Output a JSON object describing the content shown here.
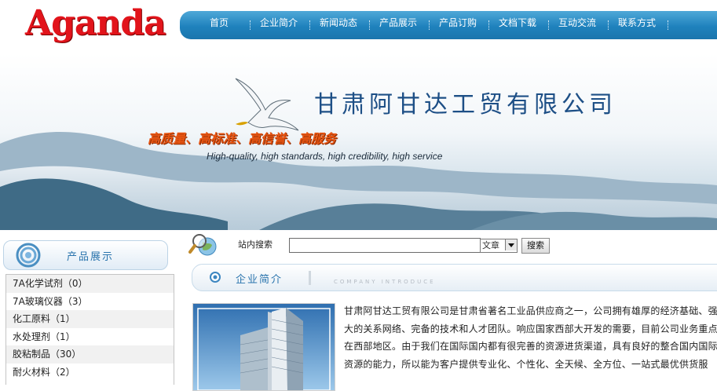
{
  "brand": {
    "logo_text": "Aganda"
  },
  "nav": {
    "items": [
      "首页",
      "企业简介",
      "新闻动态",
      "产品展示",
      "产品订购",
      "文档下载",
      "互动交流",
      "联系方式"
    ]
  },
  "banner": {
    "company_name": "甘肃阿甘达工贸有限公司",
    "slogan_cn": "高质量、高标准、高信誉、高服务",
    "slogan_en": "High-quality, high standards, high credibility, high service"
  },
  "sidebar": {
    "title": "产品展示",
    "items": [
      {
        "label": "7A化学试剂（0）"
      },
      {
        "label": "7A玻璃仪器（3）"
      },
      {
        "label": "化工原料（1）"
      },
      {
        "label": "水处理剂（1）"
      },
      {
        "label": "胶粘制品（30）"
      },
      {
        "label": "耐火材料（2）"
      }
    ]
  },
  "search": {
    "label": "站内搜索",
    "value": "",
    "scope_selected": "文章",
    "button_label": "搜索"
  },
  "section": {
    "title": "企业简介",
    "subtitle": "COMPANY INTRODUCE"
  },
  "intro": {
    "text": "甘肃阿甘达工贸有限公司是甘肃省著名工业品供应商之一，公司拥有雄厚的经济基础、强大的关系网络、完备的技术和人才团队。响应国家西部大开发的需要，目前公司业务重点在西部地区。由于我们在国际国内都有很完善的资源进货渠道，具有良好的整合国内国际资源的能力，所以能为客户提供专业化、个性化、全天候、全方位、一站式最优供货服"
  },
  "colors": {
    "logo_red": "#e2141b",
    "nav_blue": "#1f82bd",
    "title_navy": "#1d4f86",
    "slogan_orange": "#e85512",
    "section_blue": "#2a74ad"
  },
  "icons": {
    "sidebar_head": "concentric-circles-icon",
    "search": "magnifier-globe-icon",
    "section_head": "bullet-dot-icon",
    "banner_bird": "seagull-icon"
  }
}
